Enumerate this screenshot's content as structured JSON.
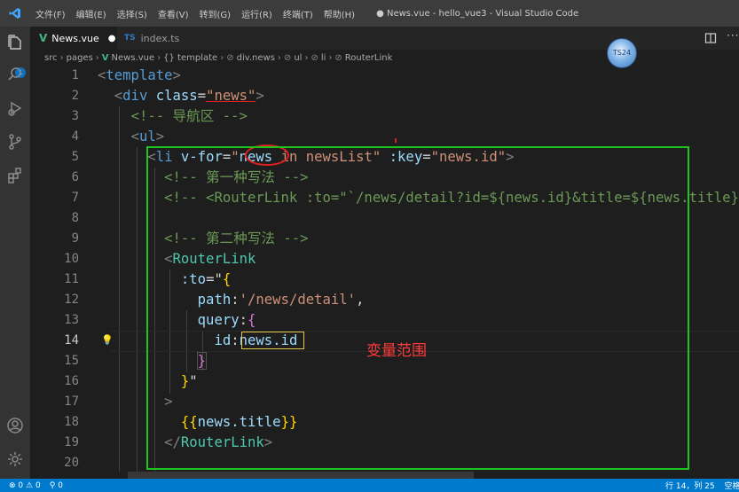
{
  "titlebar": {
    "menu": [
      "文件(F)",
      "编辑(E)",
      "选择(S)",
      "查看(V)",
      "转到(G)",
      "运行(R)",
      "终端(T)",
      "帮助(H)"
    ],
    "window_title": "● News.vue - hello_vue3 - Visual Studio Code"
  },
  "activity_bar": {
    "icons": [
      "explorer-icon",
      "search-icon",
      "run-debug-icon",
      "source-control-icon",
      "extensions-icon",
      "account-icon",
      "manage-gear-icon"
    ],
    "explorer_badge": "1"
  },
  "tabs": [
    {
      "label": "News.vue",
      "icon": "vue-icon",
      "active": true,
      "modified": true
    },
    {
      "label": "index.ts",
      "icon": "ts-icon",
      "active": false,
      "modified": false
    }
  ],
  "tab_actions": {
    "split_icon": "split-editor-icon",
    "more": "···"
  },
  "breadcrumb": [
    "src",
    "pages",
    "News.vue",
    "{} template",
    "div.news",
    "ul",
    "li",
    "RouterLink"
  ],
  "editor": {
    "active_line": 14,
    "lines": [
      {
        "n": "1"
      },
      {
        "n": "2"
      },
      {
        "n": "3"
      },
      {
        "n": "4"
      },
      {
        "n": "5"
      },
      {
        "n": "6"
      },
      {
        "n": "7"
      },
      {
        "n": "8"
      },
      {
        "n": "9"
      },
      {
        "n": "10"
      },
      {
        "n": "11"
      },
      {
        "n": "12"
      },
      {
        "n": "13"
      },
      {
        "n": "14"
      },
      {
        "n": "15"
      },
      {
        "n": "16"
      },
      {
        "n": "17"
      },
      {
        "n": "18"
      },
      {
        "n": "19"
      },
      {
        "n": "20"
      }
    ],
    "tokens": {
      "l1_tag": "template",
      "l2_tag": "div",
      "l2_attr": "class",
      "l2_val": "\"news\"",
      "l3_comment": "<!-- 导航区 -->",
      "l4_tag": "ul",
      "l5_tag": "li",
      "l5_attr": "v-for",
      "l5_q1": "\"",
      "l5_var": "news",
      "l5_rest": " in newsList\"",
      "l5_attr2": ":key",
      "l5_val2": "\"news.id\"",
      "l6_comment": "<!-- 第一种写法 -->",
      "l7_comment": "<!-- <RouterLink :to=\"`/news/detail?id=${news.id}&title=${news.title}`\">",
      "l9_comment": "<!-- 第二种写法 -->",
      "l10_tag": "RouterLink",
      "l11_attr": ":to",
      "l11_eq": "=\"",
      "l12_key": "path",
      "l12_val": "'/news/detail'",
      "l13_key": "query",
      "l14_key": "id",
      "l14_val": "news.id",
      "l16_close": "\"",
      "l18_open": "{{",
      "l18_expr": "news.title",
      "l18_close": "}}",
      "l19_tag": "RouterLink"
    }
  },
  "annotations": {
    "note": "变量范围",
    "circle_color": "#e02020",
    "box_color": "#1fc41f"
  },
  "avatar": {
    "label": "TS24"
  },
  "statusbar": {
    "errors": "0",
    "warnings": "0",
    "ports": "0",
    "position": "行 14，列 25",
    "indent": "空格"
  },
  "colors": {
    "accent": "#007acc",
    "background": "#1e1e1e"
  }
}
